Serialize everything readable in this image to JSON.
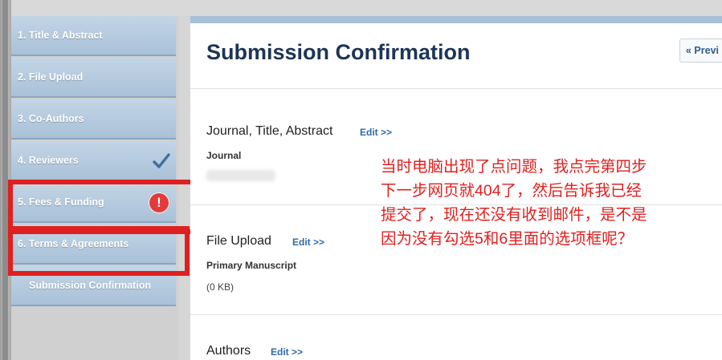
{
  "sidebar": {
    "steps": [
      {
        "label": "1. Title & Abstract"
      },
      {
        "label": "2. File Upload"
      },
      {
        "label": "3. Co-Authors"
      },
      {
        "label": "4. Reviewers",
        "status_icon": "checkmark-icon"
      },
      {
        "label": "5. Fees & Funding",
        "status_icon": "alert-icon"
      },
      {
        "label": "6. Terms & Agreements"
      },
      {
        "label": "Submission Confirmation"
      }
    ],
    "alert_symbol": "!"
  },
  "main": {
    "title": "Submission Confirmation",
    "prev_button_label": "« Previ",
    "sections": [
      {
        "title": "Journal, Title, Abstract",
        "edit_label": "Edit >>",
        "fields": [
          {
            "label": "Journal",
            "value": ""
          }
        ]
      },
      {
        "title": "File Upload",
        "edit_label": "Edit >>",
        "fields": [
          {
            "label": "Primary Manuscript",
            "value": "(0 KB)"
          }
        ]
      },
      {
        "title": "Authors",
        "edit_label": "Edit >>"
      }
    ]
  },
  "annotation": {
    "lines": [
      "当时电脑出现了点问题，我点完第四步",
      "下一步网页就404了，然后告诉我已经",
      "提交了，现在还没有收到邮件，是不是",
      "因为没有勾选5和6里面的选项框呢？"
    ],
    "color": "#e02020"
  },
  "colors": {
    "sidebar_step": "#b5cadf",
    "title": "#1d3557",
    "link": "#2f6aa3",
    "highlight_red": "#e02020"
  }
}
